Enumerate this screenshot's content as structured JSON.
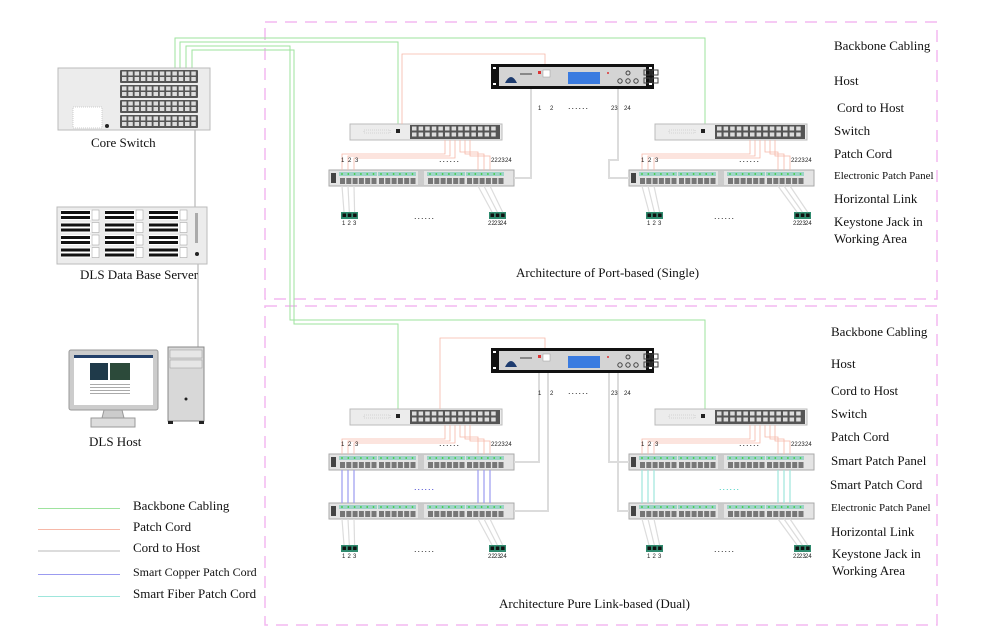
{
  "left_devices": {
    "core_switch": "Core Switch",
    "db_server": "DLS Data Base Server",
    "host": "DLS Host"
  },
  "legend": {
    "items": [
      {
        "label": "Backbone Cabling",
        "color": "#9ee39e"
      },
      {
        "label": "Patch Cord",
        "color": "#f6b8a8"
      },
      {
        "label": "Cord to Host",
        "color": "#dcdcdc"
      },
      {
        "label": "Smart Copper Patch Cord",
        "color": "#9b9bf0"
      },
      {
        "label": "Smart Fiber Patch Cord",
        "color": "#9ee6dc"
      }
    ]
  },
  "top_section": {
    "caption": "Architecture of Port-based (Single)",
    "labels": [
      "Backbone Cabling",
      "Host",
      "Cord to Host",
      "Switch",
      "Patch Cord",
      "Electronic Patch Panel",
      "Horizontal Link",
      "Keystone Jack in",
      "Working Area"
    ],
    "host_ports": [
      "1",
      "2",
      "......",
      "23",
      "24"
    ],
    "panel_ports_left": [
      "1",
      "2",
      "3"
    ],
    "panel_ports_right": [
      "22",
      "23",
      "24"
    ],
    "ellipsis": "......"
  },
  "bottom_section": {
    "caption": "Architecture Pure Link-based (Dual)",
    "labels": [
      "Backbone Cabling",
      "Host",
      "Cord to Host",
      "Switch",
      "Patch Cord",
      "Smart Patch Panel",
      "Smart Patch Cord",
      "Electronic Patch Panel",
      "Horizontal Link",
      "Keystone Jack in",
      "Working Area"
    ],
    "host_ports": [
      "1",
      "2",
      "......",
      "23",
      "24"
    ],
    "panel_ports_left": [
      "1",
      "2",
      "3"
    ],
    "panel_ports_right": [
      "22",
      "23",
      "24"
    ],
    "ellipsis": "......"
  },
  "colors": {
    "section_border": "#f4b8f0",
    "backbone": "#9ee39e",
    "patch": "#f6b8a8",
    "host_cord": "#dcdcdc",
    "copper": "#9b9bf0",
    "fiber": "#9ee6dc",
    "lcd": "#3a7be0"
  }
}
